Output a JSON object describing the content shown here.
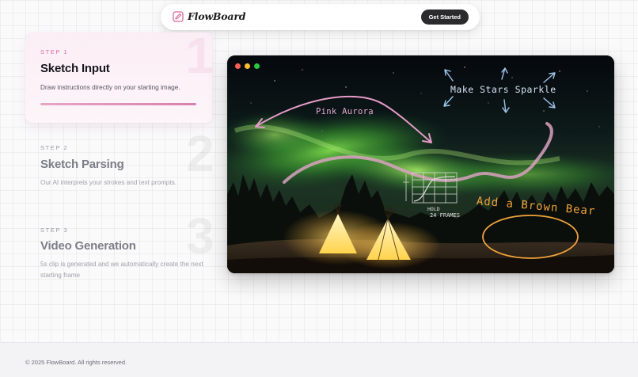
{
  "brand": {
    "name": "FlowBoard",
    "accent": "#d86a9b"
  },
  "nav": {
    "cta_label": "Get Started"
  },
  "steps": [
    {
      "kicker": "STEP 1",
      "number": "1",
      "title": "Sketch Input",
      "description": "Draw instructions directly on your starting image.",
      "active": true
    },
    {
      "kicker": "STEP 2",
      "number": "2",
      "title": "Sketch Parsing",
      "description": "Our AI interprets your strokes and text prompts.",
      "active": false
    },
    {
      "kicker": "STEP 3",
      "number": "3",
      "title": "Video Generation",
      "description": "5s clip is generated and we automatically create the next starting frame",
      "active": false
    }
  ],
  "preview": {
    "annotations": {
      "aurora": "Pink Aurora",
      "stars": "Make Stars Sparkle",
      "bear": "Add a Brown Bear",
      "hold": "HOLD",
      "frames": "24 FRAMES"
    }
  },
  "footer": {
    "copyright": "© 2025 FlowBoard. All rights reserved."
  }
}
